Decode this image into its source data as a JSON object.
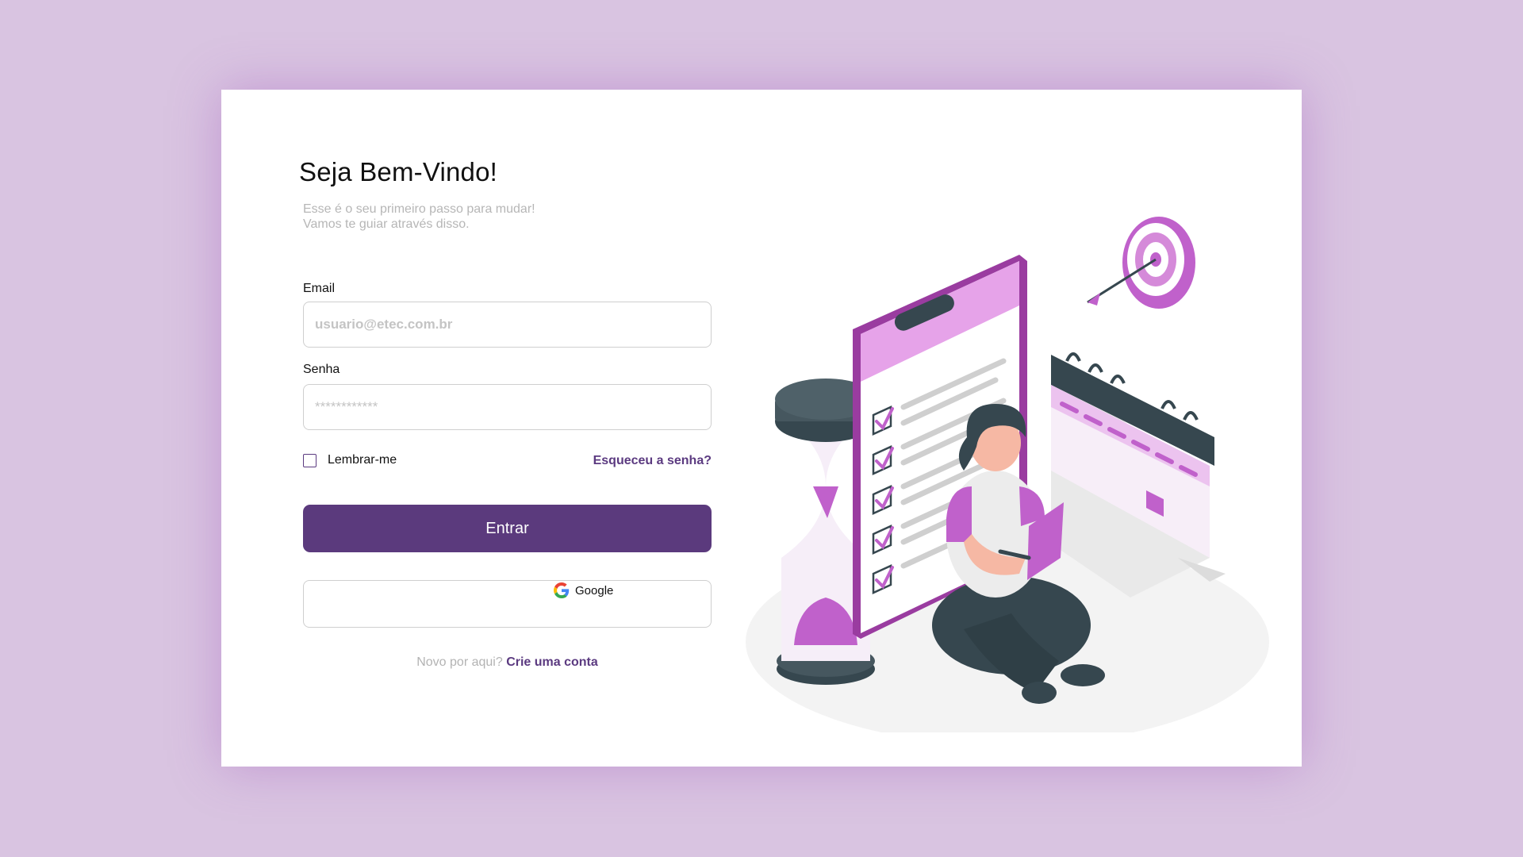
{
  "page": {
    "title": "Seja Bem-Vindo!",
    "subtitle_line1": "Esse é o seu primeiro passo para mudar!",
    "subtitle_line2": "Vamos te guiar através disso."
  },
  "form": {
    "email_label": "Email",
    "email_placeholder": "usuario@etec.com.br",
    "password_label": "Senha",
    "password_placeholder": "************",
    "remember_label": "Lembrar-me",
    "forgot_label": "Esqueceu a senha?",
    "submit_label": "Entrar",
    "google_label": "Google",
    "signup_prompt": "Novo por aqui?",
    "signup_link": "Crie uma conta"
  },
  "colors": {
    "background": "#d9c4e1",
    "card": "#ffffff",
    "primary": "#5b3a7d",
    "accent_link": "#5b3a80",
    "illustration_purple": "#c061cb",
    "illustration_dark": "#36474f"
  },
  "illustration": {
    "icon": "woman-with-checklist-calendar-target-illustration"
  }
}
